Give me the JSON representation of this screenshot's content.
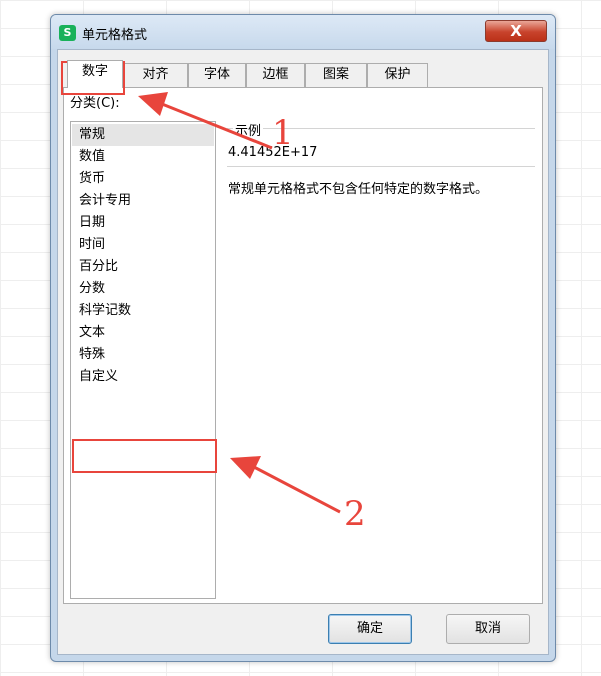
{
  "dialog": {
    "title": "单元格格式",
    "app_icon_letter": "S",
    "close_glyph": "X"
  },
  "tabs": [
    {
      "label": "数字",
      "active": true
    },
    {
      "label": "对齐"
    },
    {
      "label": "字体"
    },
    {
      "label": "边框"
    },
    {
      "label": "图案"
    },
    {
      "label": "保护"
    }
  ],
  "category": {
    "label": "分类(C):",
    "items": [
      "常规",
      "数值",
      "货币",
      "会计专用",
      "日期",
      "时间",
      "百分比",
      "分数",
      "科学记数",
      "文本",
      "特殊",
      "自定义"
    ],
    "selected": "常规"
  },
  "sample": {
    "title": "示例",
    "value": "4.41452E+17"
  },
  "description": "常规单元格格式不包含任何特定的数字格式。",
  "buttons": {
    "ok": "确定",
    "cancel": "取消"
  },
  "annotations": {
    "label_1": "1",
    "label_2": "2",
    "color": "#e8453c"
  },
  "icons": [
    "close-icon",
    "app-logo-icon"
  ]
}
